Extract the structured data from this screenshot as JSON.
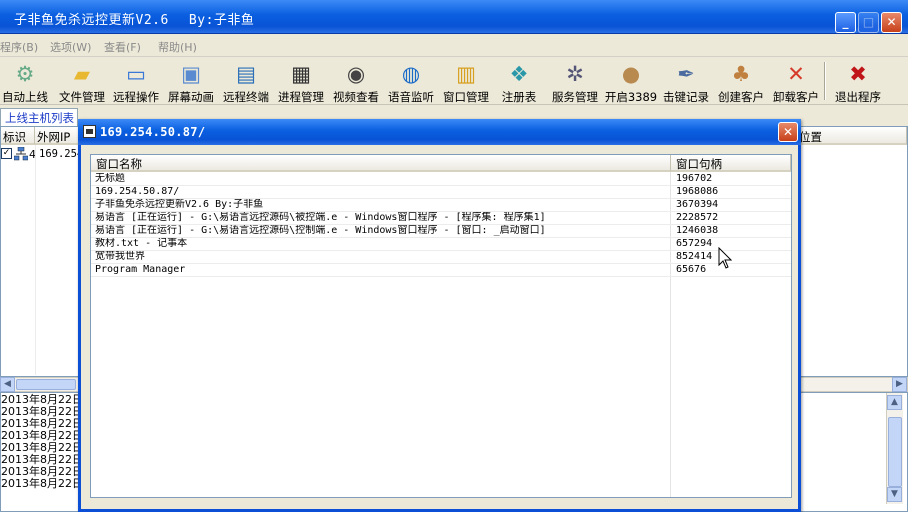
{
  "app": {
    "title": "子非鱼免杀远控更新V2.6",
    "author": "By:子非鱼"
  },
  "menu": [
    "程序(B)",
    "选项(W)",
    "查看(F)",
    "帮助(H)"
  ],
  "toolbar": [
    {
      "label": "自动上线",
      "icon": "auto-online-icon"
    },
    {
      "label": "文件管理",
      "icon": "folder-icon"
    },
    {
      "label": "远程操作",
      "icon": "monitor-icon"
    },
    {
      "label": "屏幕动画",
      "icon": "screen-icon"
    },
    {
      "label": "远程终端",
      "icon": "terminal-icon"
    },
    {
      "label": "进程管理",
      "icon": "process-icon"
    },
    {
      "label": "视频查看",
      "icon": "webcam-icon"
    },
    {
      "label": "语音监听",
      "icon": "audio-icon"
    },
    {
      "label": "窗口管理",
      "icon": "window-icon"
    },
    {
      "label": "注册表",
      "icon": "registry-icon"
    },
    {
      "label": "服务管理",
      "icon": "service-icon"
    },
    {
      "label": "开启3389",
      "icon": "user-icon"
    },
    {
      "label": "击键记录",
      "icon": "keylog-icon"
    },
    {
      "label": "创建客户",
      "icon": "users-icon"
    },
    {
      "label": "卸载客户",
      "icon": "uninstall-icon"
    },
    {
      "label": "退出程序",
      "icon": "exit-icon"
    }
  ],
  "host_tab": "上线主机列表",
  "host_columns": [
    "标识",
    "外网IP",
    "位置"
  ],
  "host_row": {
    "id": "4",
    "ip": "169.254"
  },
  "log_rows": [
    "2013年8月22日",
    "2013年8月22日",
    "2013年8月22日",
    "2013年8月22日",
    "2013年8月22日",
    "2013年8月22日",
    "2013年8月22日",
    "2013年8月22日"
  ],
  "dialog": {
    "title": "169.254.50.87/",
    "columns": [
      "窗口名称",
      "窗口句柄"
    ],
    "rows": [
      {
        "name": "无标题",
        "handle": "196702"
      },
      {
        "name": "169.254.50.87/",
        "handle": "1968086"
      },
      {
        "name": "子非鱼免杀远控更新V2.6    By:子非鱼",
        "handle": "3670394"
      },
      {
        "name": "易语言 [正在运行] - G:\\易语言远控源码\\被控端.e - Windows窗口程序 - [程序集: 程序集1]",
        "handle": "2228572"
      },
      {
        "name": "易语言 [正在运行] - G:\\易语言远控源码\\控制端.e - Windows窗口程序 - [窗口: _启动窗口]",
        "handle": "1246038"
      },
      {
        "name": "教材.txt - 记事本",
        "handle": "657294"
      },
      {
        "name": "宽带我世界",
        "handle": "852414"
      },
      {
        "name": "Program Manager",
        "handle": "65676"
      }
    ]
  }
}
